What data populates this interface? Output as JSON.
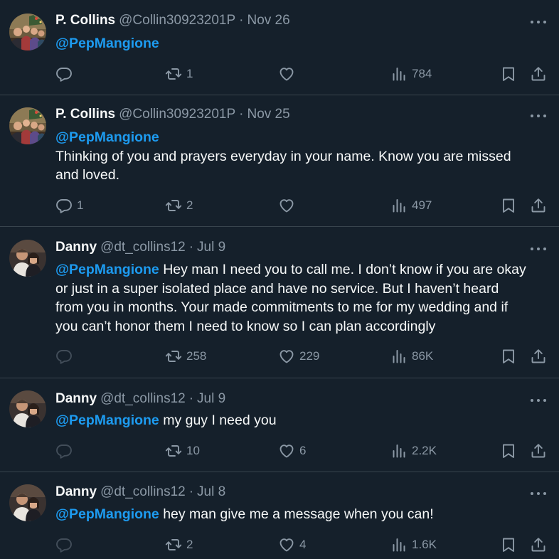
{
  "tweets": [
    {
      "name": "P. Collins",
      "handle": "@Collin30923201P",
      "sep": "·",
      "date": "Nov 26",
      "mention": "@PepMangione",
      "text": "",
      "replies": "",
      "retweets": "1",
      "likes": "",
      "views": "784",
      "reply_disabled": false
    },
    {
      "name": "P. Collins",
      "handle": "@Collin30923201P",
      "sep": "·",
      "date": "Nov 25",
      "mention": "@PepMangione",
      "text_line1": "Thinking of you and prayers everyday in your name. Know you are missed",
      "text_line2": "and loved.",
      "replies": "1",
      "retweets": "2",
      "likes": "",
      "views": "497",
      "reply_disabled": false
    },
    {
      "name": "Danny",
      "handle": "@dt_collins12",
      "sep": "·",
      "date": "Jul 9",
      "mention": "@PepMangione",
      "text_line1": " Hey man I need you to call me. I don’t know if you are okay",
      "text_line2": "or just in a super isolated place and have no service. But I haven’t heard",
      "text_line3": "from you in months. Your made commitments to me for my wedding and if",
      "text_line4": "you can’t honor them I need to know so I can plan accordingly",
      "replies": "",
      "retweets": "258",
      "likes": "229",
      "views": "86K",
      "reply_disabled": true
    },
    {
      "name": "Danny",
      "handle": "@dt_collins12",
      "sep": "·",
      "date": "Jul 9",
      "mention": "@PepMangione",
      "text": " my guy I need you",
      "replies": "",
      "retweets": "10",
      "likes": "6",
      "views": "2.2K",
      "reply_disabled": true
    },
    {
      "name": "Danny",
      "handle": "@dt_collins12",
      "sep": "·",
      "date": "Jul 8",
      "mention": "@PepMangione",
      "text": " hey man give me a message when you can!",
      "replies": "",
      "retweets": "2",
      "likes": "4",
      "views": "1.6K",
      "reply_disabled": true
    }
  ],
  "icons": {
    "reply": "speech-bubble",
    "retweet": "two-arrows-loop",
    "like": "heart",
    "views": "bar-chart",
    "bookmark": "bookmark",
    "share": "arrow-up-tray",
    "more": "three-dots"
  },
  "colors": {
    "background": "#15202b",
    "divider": "#38444d",
    "text": "#f7f9f9",
    "secondary": "#8b98a5",
    "mention": "#1d9bf0"
  }
}
